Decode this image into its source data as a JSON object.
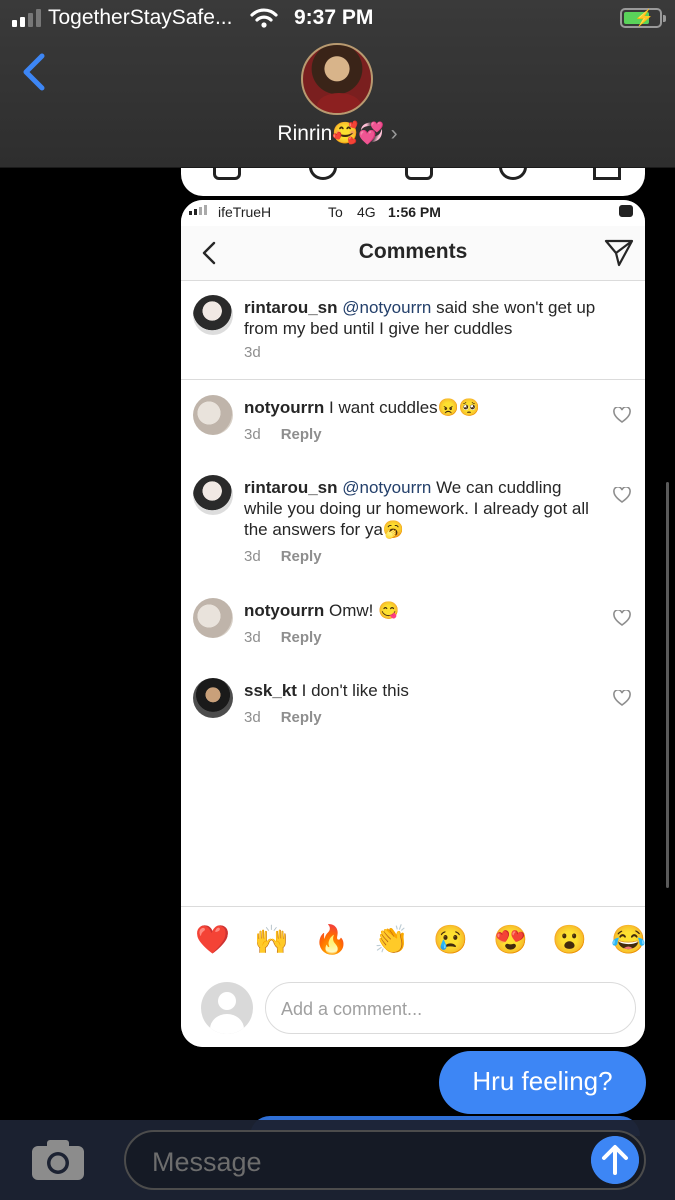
{
  "status_bar": {
    "carrier": "TogetherStaySafe...",
    "time": "9:37 PM"
  },
  "conversation": {
    "contact_name": "Rinrin🥰💞",
    "chevron": "›"
  },
  "shared_screenshot": {
    "status_bar": {
      "carrier": "ifeTrueH",
      "carrier_extra": "To",
      "network": "4G",
      "time": "1:56 PM"
    },
    "header": {
      "title": "Comments"
    },
    "caption": {
      "username": "rintarou_sn",
      "mention": "@notyourrn",
      "text": " said she won't get up from my bed until I give her cuddles",
      "time": "3d"
    },
    "comments": [
      {
        "username": "notyourrn",
        "text": " I want cuddles😠🥺",
        "time": "3d",
        "reply": "Reply"
      },
      {
        "username": "rintarou_sn",
        "mention": "@notyourrn",
        "text": " We can cuddling while you doing ur homework. I already got all the answers for ya🥱",
        "time": "3d",
        "reply": "Reply"
      },
      {
        "username": "notyourrn",
        "text": " Omw! 😋",
        "time": "3d",
        "reply": "Reply"
      },
      {
        "username": "ssk_kt",
        "text": " I don't like this",
        "time": "3d",
        "reply": "Reply"
      }
    ],
    "quick_emojis": [
      "❤️",
      "🙌",
      "🔥",
      "👏",
      "😢",
      "😍",
      "😮",
      "😂"
    ],
    "add_comment_placeholder": "Add a comment..."
  },
  "messages": [
    {
      "text": "Hru feeling?",
      "from": "me"
    }
  ],
  "input": {
    "placeholder": "Message"
  },
  "colors": {
    "imessage_blue": "#3d86f5",
    "mention_blue": "#24406b",
    "meta_gray": "#8e8e8e"
  }
}
